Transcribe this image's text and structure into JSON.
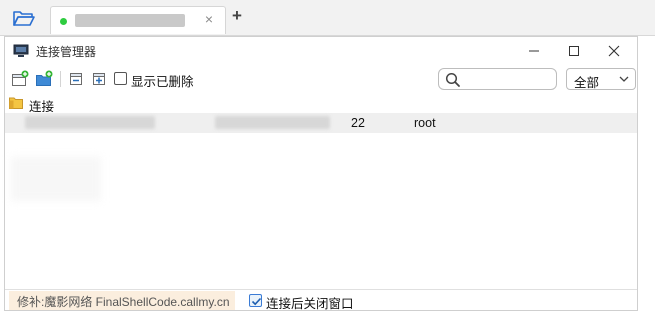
{
  "app": {
    "tab": {
      "title": ""
    },
    "icons": [
      "folder-open-icon",
      "status-dot-icon",
      "close-icon",
      "plus-icon"
    ]
  },
  "dialog": {
    "title": "连接管理器",
    "toolbar": {
      "show_deleted_label": "显示已删除",
      "show_deleted_checked": false,
      "search_placeholder": "",
      "filter_value": "全部"
    },
    "tree": {
      "folder_label": "连接",
      "rows": [
        {
          "name": "",
          "host": "",
          "port": "22",
          "user": "root"
        }
      ]
    },
    "statusbar": {
      "watermark": "修补:魔影网络 FinalShellCode.callmy.cn",
      "close_after_connect_label": "连接后关闭窗口",
      "close_after_connect_checked": true
    }
  },
  "colors": {
    "status_green": "#2ecc40",
    "folder_yellow": "#f4c542",
    "accent_blue": "#3a7bd5",
    "watermark_bg": "#fbeede"
  }
}
